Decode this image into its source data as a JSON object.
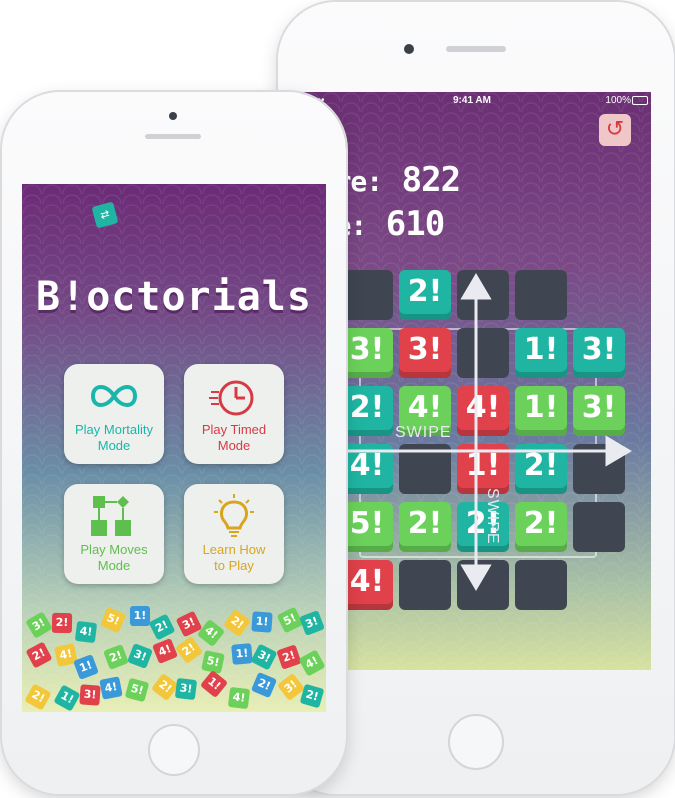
{
  "colors": {
    "green": "#6bd15a",
    "red": "#e0414b",
    "teal": "#1fb5a2",
    "yellow": "#f2c73b",
    "blue": "#3a9ad9",
    "empty": "#3f4652",
    "menu_text_teal": "#19b6a9",
    "menu_text_red": "#d53a45",
    "menu_text_green": "#5fbf4e",
    "menu_text_yellow": "#d9a51d"
  },
  "game_screen": {
    "status": {
      "carrier_signal": "•••••",
      "time": "9:41 AM",
      "battery": "100%"
    },
    "menu_icon": "menu-icon",
    "restart_icon": "restart-icon",
    "score_label": "Score:",
    "score_value": "822",
    "best_label": "core:",
    "best_value": "610",
    "swipe_horizontal": "SWIPE",
    "swipe_vertical": "SWIPE",
    "rows": [
      [
        "",
        "2!",
        "",
        "",
        ""
      ],
      [
        "3!",
        "3!",
        "",
        "1!",
        "3!"
      ],
      [
        "2!",
        "4!",
        "4!",
        "1!",
        "3!"
      ],
      [
        "4!",
        "",
        "1!",
        "2!",
        ""
      ],
      [
        "5!",
        "2!",
        "2!",
        "2!",
        ""
      ],
      [
        "4!",
        "",
        "",
        "",
        ""
      ]
    ],
    "row_colors": [
      [
        "empty",
        "teal",
        "empty",
        "empty",
        ""
      ],
      [
        "green",
        "red",
        "empty",
        "teal",
        "teal"
      ],
      [
        "teal",
        "green",
        "red",
        "green",
        "green"
      ],
      [
        "teal",
        "empty",
        "red",
        "teal",
        "empty"
      ],
      [
        "green",
        "green",
        "teal",
        "green",
        "empty"
      ],
      [
        "red",
        "empty",
        "empty",
        "empty",
        ""
      ]
    ]
  },
  "menu_screen": {
    "title": "B!octorials",
    "buttons": [
      {
        "label_line1": "Play Mortality",
        "label_line2": "Mode",
        "icon": "infinity-icon",
        "color": "teal"
      },
      {
        "label_line1": "Play Timed",
        "label_line2": "Mode",
        "icon": "stopwatch-icon",
        "color": "red"
      },
      {
        "label_line1": "Play Moves",
        "label_line2": "Mode",
        "icon": "flowchart-icon",
        "color": "green"
      },
      {
        "label_line1": "Learn How",
        "label_line2": "to Play",
        "icon": "lightbulb-icon",
        "color": "yellow"
      }
    ],
    "chips": [
      "3!",
      "2!",
      "4!",
      "5!",
      "1!",
      "2!",
      "3!",
      "4!",
      "2!",
      "1!",
      "5!",
      "3!",
      "2!",
      "4!",
      "1!",
      "2!",
      "3!",
      "4!",
      "2!",
      "5!",
      "1!",
      "3!",
      "2!",
      "4!",
      "2!",
      "1!",
      "3!",
      "4!",
      "5!",
      "2!",
      "3!",
      "1!",
      "4!",
      "2!",
      "3!",
      "2!"
    ],
    "chip_colors": [
      "green",
      "red",
      "teal",
      "yellow",
      "blue",
      "teal",
      "red",
      "green",
      "yellow",
      "blue",
      "green",
      "teal",
      "red",
      "yellow",
      "blue",
      "green",
      "teal",
      "red",
      "yellow",
      "green",
      "blue",
      "teal",
      "red",
      "green",
      "yellow",
      "teal",
      "red",
      "blue",
      "green",
      "yellow",
      "teal",
      "red",
      "green",
      "blue",
      "yellow",
      "teal"
    ]
  }
}
